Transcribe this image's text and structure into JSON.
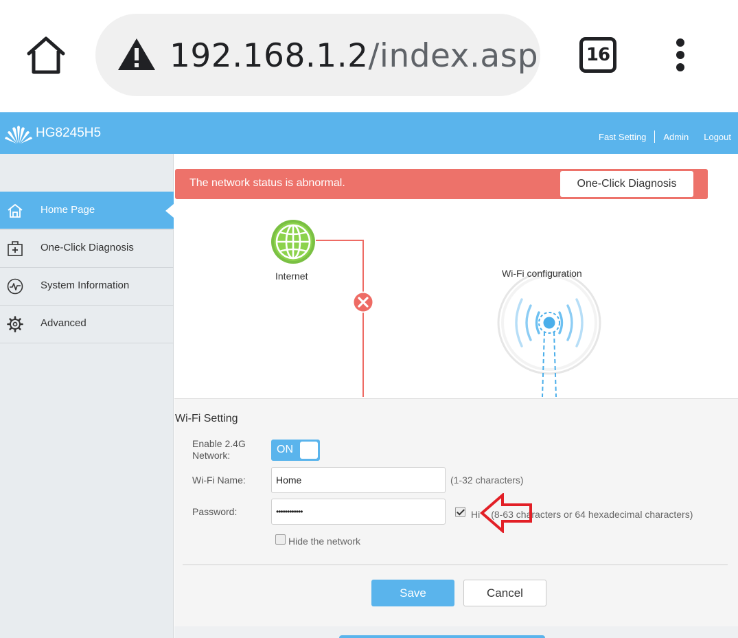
{
  "browser": {
    "url_host": "192.168.1.2",
    "url_path": "/index.asp",
    "tab_count": "16",
    "icons": {
      "home": "home-icon",
      "warning": "warning-triangle-icon",
      "menu": "more-vert-icon"
    }
  },
  "header": {
    "model": "HG8245H5",
    "links": {
      "fast_setting": "Fast Setting",
      "admin": "Admin",
      "logout": "Logout"
    },
    "colors": {
      "brand": "#5ab4ec"
    }
  },
  "sidebar": {
    "items": [
      {
        "label": "Home Page",
        "icon": "home-icon",
        "active": true
      },
      {
        "label": "One-Click Diagnosis",
        "icon": "medical-kit-icon",
        "active": false
      },
      {
        "label": "System Information",
        "icon": "pulse-icon",
        "active": false
      },
      {
        "label": "Advanced",
        "icon": "gear-icon",
        "active": false
      }
    ]
  },
  "alert": {
    "message": "The network status is abnormal.",
    "button_label": "One-Click Diagnosis",
    "color": "#ed726a"
  },
  "topology": {
    "internet_label": "Internet",
    "wifi_label": "Wi-Fi configuration",
    "link_status": "error"
  },
  "wifi_setting": {
    "title": "Wi-Fi Setting",
    "enable_label_line1": "Enable 2.4G",
    "enable_label_line2": "Network:",
    "toggle_text": "ON",
    "name_label": "Wi-Fi Name:",
    "name_value": "Home",
    "name_hint": "(1-32 characters)",
    "password_label": "Password:",
    "password_value": "••••••••••••",
    "hide_prefix": "Hi",
    "hide_suffix": "(8-63 characters or 64 hexadecimal characters)",
    "hide_network_label": "Hide the network",
    "save_label": "Save",
    "cancel_label": "Cancel"
  }
}
